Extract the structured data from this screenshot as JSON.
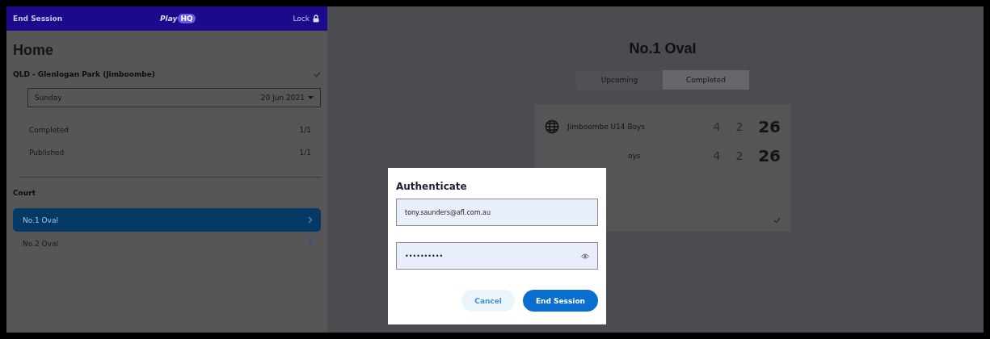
{
  "top_bar": {
    "left_action": "End Session",
    "logo_text": "Play",
    "logo_badge": "HQ",
    "lock_label": "Lock"
  },
  "sidebar": {
    "title": "Home",
    "venue": {
      "name": "QLD - Glenlogan Park (Jimboombe)",
      "checked": true
    },
    "date_select": {
      "day": "Sunday",
      "date": "20 Jun 2021"
    },
    "stats": [
      {
        "label": "Completed",
        "value": "1/1"
      },
      {
        "label": "Published",
        "value": "1/1"
      }
    ],
    "court_heading": "Court",
    "courts": [
      {
        "label": "No.1 Oval",
        "selected": true
      },
      {
        "label": "No.2 Oval",
        "selected": false
      }
    ]
  },
  "main": {
    "title": "No.1 Oval",
    "tabs": [
      {
        "label": "Upcoming",
        "selected": false
      },
      {
        "label": "Completed",
        "selected": true
      }
    ],
    "matches": [
      {
        "team": "Jimboombe U14 Boys",
        "covered": false,
        "goals": "4",
        "behinds": "2",
        "score": "26"
      },
      {
        "team": "oys",
        "covered": true,
        "goals": "4",
        "behinds": "2",
        "score": "26"
      }
    ],
    "card_checked": true
  },
  "dialog": {
    "title": "Authenticate",
    "email": "tony.saunders@afl.com.au",
    "password": "••••••••••",
    "buttons": [
      {
        "label": "Cancel",
        "kind": "secondary"
      },
      {
        "label": "End Session",
        "kind": "primary"
      }
    ]
  }
}
